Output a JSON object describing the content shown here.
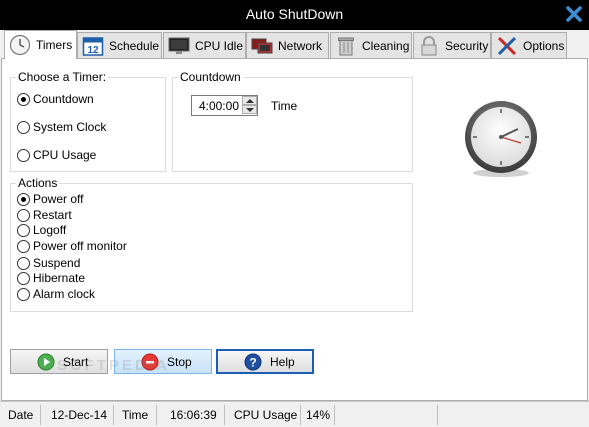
{
  "window": {
    "title": "Auto ShutDown"
  },
  "tabs": [
    {
      "label": "Timers",
      "icon": "clock-icon",
      "active": true
    },
    {
      "label": "Schedule",
      "icon": "calendar-icon",
      "active": false
    },
    {
      "label": "CPU Idle",
      "icon": "monitor-icon",
      "active": false
    },
    {
      "label": "Network",
      "icon": "network-icon",
      "active": false
    },
    {
      "label": "Cleaning",
      "icon": "trash-icon",
      "active": false
    },
    {
      "label": "Security",
      "icon": "lock-icon",
      "active": false
    },
    {
      "label": "Options",
      "icon": "tools-icon",
      "active": false
    }
  ],
  "timer_group": {
    "title": "Choose a Timer:",
    "options": [
      {
        "label": "Countdown",
        "checked": true
      },
      {
        "label": "System Clock",
        "checked": false
      },
      {
        "label": "CPU Usage",
        "checked": false
      }
    ]
  },
  "countdown_group": {
    "title": "Countdown",
    "value": "4:00:00",
    "unit_label": "Time"
  },
  "actions_group": {
    "title": "Actions",
    "options": [
      {
        "label": "Power off",
        "checked": true
      },
      {
        "label": "Restart",
        "checked": false
      },
      {
        "label": "Logoff",
        "checked": false
      },
      {
        "label": "Power off monitor",
        "checked": false
      },
      {
        "label": "Suspend",
        "checked": false
      },
      {
        "label": "Hibernate",
        "checked": false
      },
      {
        "label": "Alarm clock",
        "checked": false
      }
    ]
  },
  "buttons": {
    "start": "Start",
    "stop": "Stop",
    "help": "Help"
  },
  "watermark": "SOFTPEDIA",
  "status": {
    "date_label": "Date",
    "date_value": "12-Dec-14",
    "time_label": "Time",
    "time_value": "16:06:39",
    "cpu_label": "CPU Usage",
    "cpu_value": "14%"
  },
  "colors": {
    "titlebar": "#000000",
    "close_icon": "#3a8fd6",
    "active_tab": "#ffffff",
    "stop_button_highlight": "#cce4f7",
    "help_button_border": "#1a5fb4"
  }
}
